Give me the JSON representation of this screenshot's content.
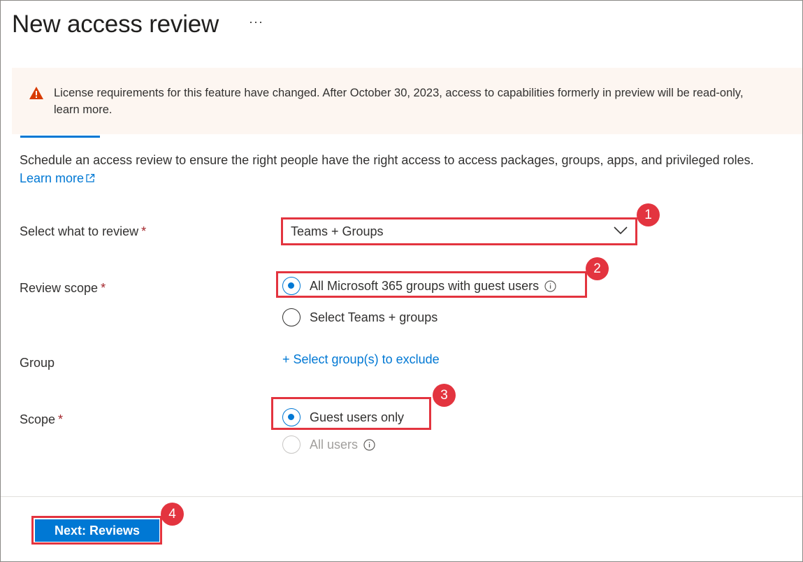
{
  "header": {
    "title": "New access review",
    "more_label": "···"
  },
  "banner": {
    "line1": "License requirements for this feature have changed. After October 30, 2023, access to capabilities formerly in preview will be read-only, ",
    "line2": "learn more.",
    "icon": "warning-icon"
  },
  "intro": {
    "description": "Schedule an access review to ensure the right people have the right access to access packages, groups, apps, and privileged roles.",
    "learn_more": "Learn more"
  },
  "form": {
    "select_label": "Select what to review",
    "select_value": "Teams + Groups",
    "scope_label": "Review scope",
    "scope_options": [
      "All Microsoft 365 groups with guest users",
      "Select Teams + groups"
    ],
    "group_label": "Group",
    "group_link": "+ Select group(s) to exclude",
    "users_label": "Scope",
    "users_options": [
      "Guest users only",
      "All users"
    ],
    "required_mark": "*"
  },
  "footer": {
    "next_label": "Next: Reviews"
  },
  "annotations": [
    "1",
    "2",
    "3",
    "4"
  ],
  "colors": {
    "accent": "#0078d4",
    "highlight": "#e3343f",
    "warning": "#d83b01",
    "banner_bg": "#fdf6f1"
  }
}
